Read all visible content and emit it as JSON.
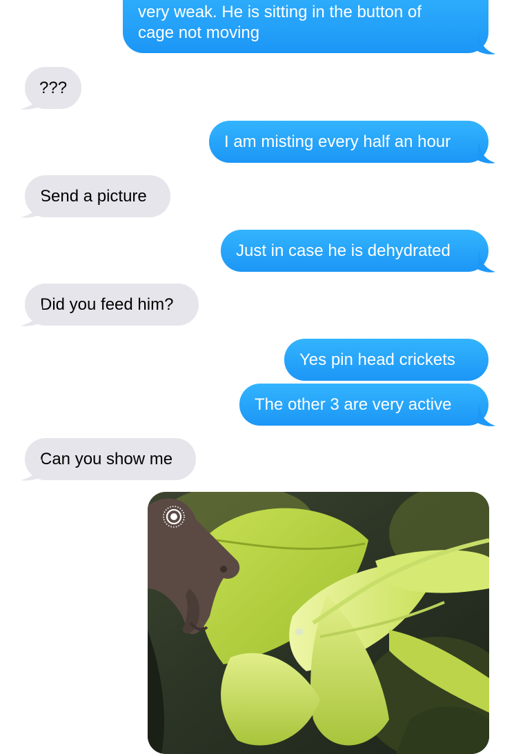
{
  "messages": [
    {
      "from": "me",
      "text_line1": "very weak. He is sitting in the button of",
      "text_line2": "cage not moving"
    },
    {
      "from": "them",
      "text": "???"
    },
    {
      "from": "me",
      "text": "I am misting every half an hour"
    },
    {
      "from": "them",
      "text": "Send a picture"
    },
    {
      "from": "me",
      "text": "Just in case he is dehydrated"
    },
    {
      "from": "them",
      "text": "Did you feed him?"
    },
    {
      "from": "me",
      "text": "Yes pin head crickets"
    },
    {
      "from": "me",
      "text": "The other 3 are very active"
    },
    {
      "from": "them",
      "text": "Can you show me"
    }
  ],
  "photo": {
    "live_icon": "live-photo-icon",
    "colors": {
      "leaf_light": "#d9ec6a",
      "leaf_mid": "#b7cf3d",
      "leaf_dark": "#5a6a1c",
      "background_dark": "#2a3324",
      "chameleon": "#5b4a44"
    }
  },
  "colors": {
    "sent_bubble": "#1e9bf8",
    "received_bubble": "#e6e5eb",
    "sent_text": "#ffffff",
    "received_text": "#000000"
  }
}
